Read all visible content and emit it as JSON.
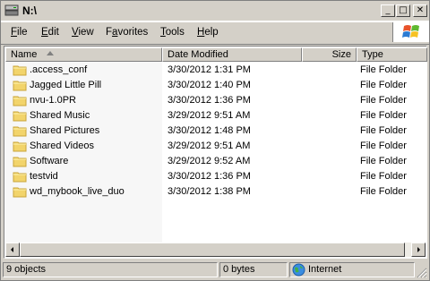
{
  "window": {
    "title": "N:\\"
  },
  "titlebar": {
    "minimize_glyph": "_",
    "maximize_glyph": "□",
    "close_glyph": "✕"
  },
  "menu": [
    {
      "accel": "F",
      "rest": "ile"
    },
    {
      "accel": "E",
      "rest": "dit"
    },
    {
      "accel": "V",
      "rest": "iew"
    },
    {
      "pre": "F",
      "accel": "a",
      "rest": "vorites"
    },
    {
      "accel": "T",
      "rest": "ools"
    },
    {
      "accel": "H",
      "rest": "elp"
    }
  ],
  "columns": {
    "name": "Name",
    "date": "Date Modified",
    "size": "Size",
    "type": "Type"
  },
  "rows": [
    {
      "name": ".access_conf",
      "date": "3/30/2012 1:31 PM",
      "size": "",
      "type": "File Folder"
    },
    {
      "name": "Jagged Little Pill",
      "date": "3/30/2012 1:40 PM",
      "size": "",
      "type": "File Folder"
    },
    {
      "name": "nvu-1.0PR",
      "date": "3/30/2012 1:36 PM",
      "size": "",
      "type": "File Folder"
    },
    {
      "name": "Shared Music",
      "date": "3/29/2012 9:51 AM",
      "size": "",
      "type": "File Folder"
    },
    {
      "name": "Shared Pictures",
      "date": "3/30/2012 1:48 PM",
      "size": "",
      "type": "File Folder"
    },
    {
      "name": "Shared Videos",
      "date": "3/29/2012 9:51 AM",
      "size": "",
      "type": "File Folder"
    },
    {
      "name": "Software",
      "date": "3/29/2012 9:52 AM",
      "size": "",
      "type": "File Folder"
    },
    {
      "name": "testvid",
      "date": "3/30/2012 1:36 PM",
      "size": "",
      "type": "File Folder"
    },
    {
      "name": "wd_mybook_live_duo",
      "date": "3/30/2012 1:38 PM",
      "size": "",
      "type": "File Folder"
    }
  ],
  "status": {
    "objects": "9 objects",
    "size": "0 bytes",
    "zone": "Internet"
  },
  "colors": {
    "folder": "#f2d46b",
    "folder_edge": "#c9a43a",
    "chrome": "#d4d0c8"
  },
  "icons": {
    "window": "drive-window-icon",
    "folder": "folder-icon",
    "zone": "globe-icon",
    "logo": "windows-logo-icon"
  }
}
